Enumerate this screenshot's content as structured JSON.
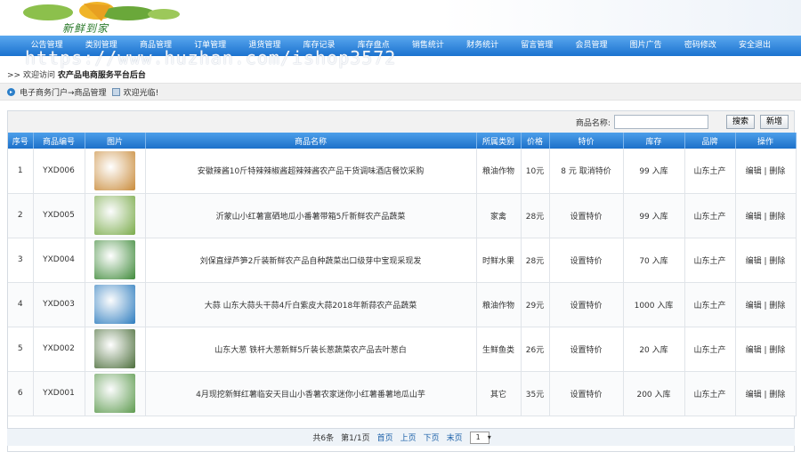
{
  "header": {
    "logo_text": "新鲜到家"
  },
  "nav": [
    "公告管理",
    "类别管理",
    "商品管理",
    "订单管理",
    "退货管理",
    "库存记录",
    "库存盘点",
    "销售统计",
    "财务统计",
    "留言管理",
    "会员管理",
    "图片广告",
    "密码修改",
    "安全退出"
  ],
  "watermark": "https://www.huzhan.com/ishop3572",
  "welcome": {
    "prefix": ">> 欢迎访问",
    "site": "农产品电商服务平台后台"
  },
  "breadcrumb": {
    "portal": "电子商务门户",
    "arrow": "→商品管理",
    "greeting": "欢迎光临!"
  },
  "search": {
    "label": "商品名称:",
    "value": "",
    "search_btn": "搜索",
    "add_btn": "新增"
  },
  "columns": [
    "序号",
    "商品编号",
    "图片",
    "商品名称",
    "所属类别",
    "价格",
    "特价",
    "库存",
    "品牌",
    "操作"
  ],
  "rows": [
    {
      "idx": "1",
      "code": "YXD006",
      "img": "#c98b3a",
      "name": "安徽辣酱10斤特辣辣椒酱超辣辣酱农产品干货调味酒店餐饮采购",
      "category": "粮油作物",
      "price": "10元",
      "special": "8 元 取消特价",
      "stock": "99 入库",
      "brand": "山东土产",
      "edit": "编辑",
      "del": "删除"
    },
    {
      "idx": "2",
      "code": "YXD005",
      "img": "#7aab4a",
      "name": "沂蒙山小红薯富硒地瓜小番薯带箱5斤新鲜农产品蔬菜",
      "category": "家禽",
      "price": "28元",
      "special": "设置特价",
      "stock": "99 入库",
      "brand": "山东土产",
      "edit": "编辑",
      "del": "删除"
    },
    {
      "idx": "3",
      "code": "YXD004",
      "img": "#3f8a3a",
      "name": "刘保直绿芦笋2斤装新鲜农产品自种蔬菜出口级芽中宝现采现发",
      "category": "时鲜水果",
      "price": "28元",
      "special": "设置特价",
      "stock": "70 入库",
      "brand": "山东土产",
      "edit": "编辑",
      "del": "删除"
    },
    {
      "idx": "4",
      "code": "YXD003",
      "img": "#2e7dbf",
      "name": "大蒜 山东大蒜头干蒜4斤白紫皮大蒜2018年新蒜农产品蔬菜",
      "category": "粮油作物",
      "price": "29元",
      "special": "设置特价",
      "stock": "1000 入库",
      "brand": "山东土产",
      "edit": "编辑",
      "del": "删除"
    },
    {
      "idx": "5",
      "code": "YXD002",
      "img": "#4c6e3b",
      "name": "山东大葱 铁杆大葱新鲜5斤装长葱蔬菜农产品去叶葱白",
      "category": "生鲜鱼类",
      "price": "26元",
      "special": "设置特价",
      "stock": "20 入库",
      "brand": "山东土产",
      "edit": "编辑",
      "del": "删除"
    },
    {
      "idx": "6",
      "code": "YXD001",
      "img": "#5e9b4f",
      "name": "4月现挖新鲜红薯临安天目山小香薯农家迷你小红薯番薯地瓜山芋",
      "category": "其它",
      "price": "35元",
      "special": "设置特价",
      "stock": "200 入库",
      "brand": "山东土产",
      "edit": "编辑",
      "del": "删除"
    }
  ],
  "pager": {
    "total": "共6条",
    "page": "第1/1页",
    "first": "首页",
    "prev": "上页",
    "next": "下页",
    "last": "末页",
    "select": "1"
  }
}
